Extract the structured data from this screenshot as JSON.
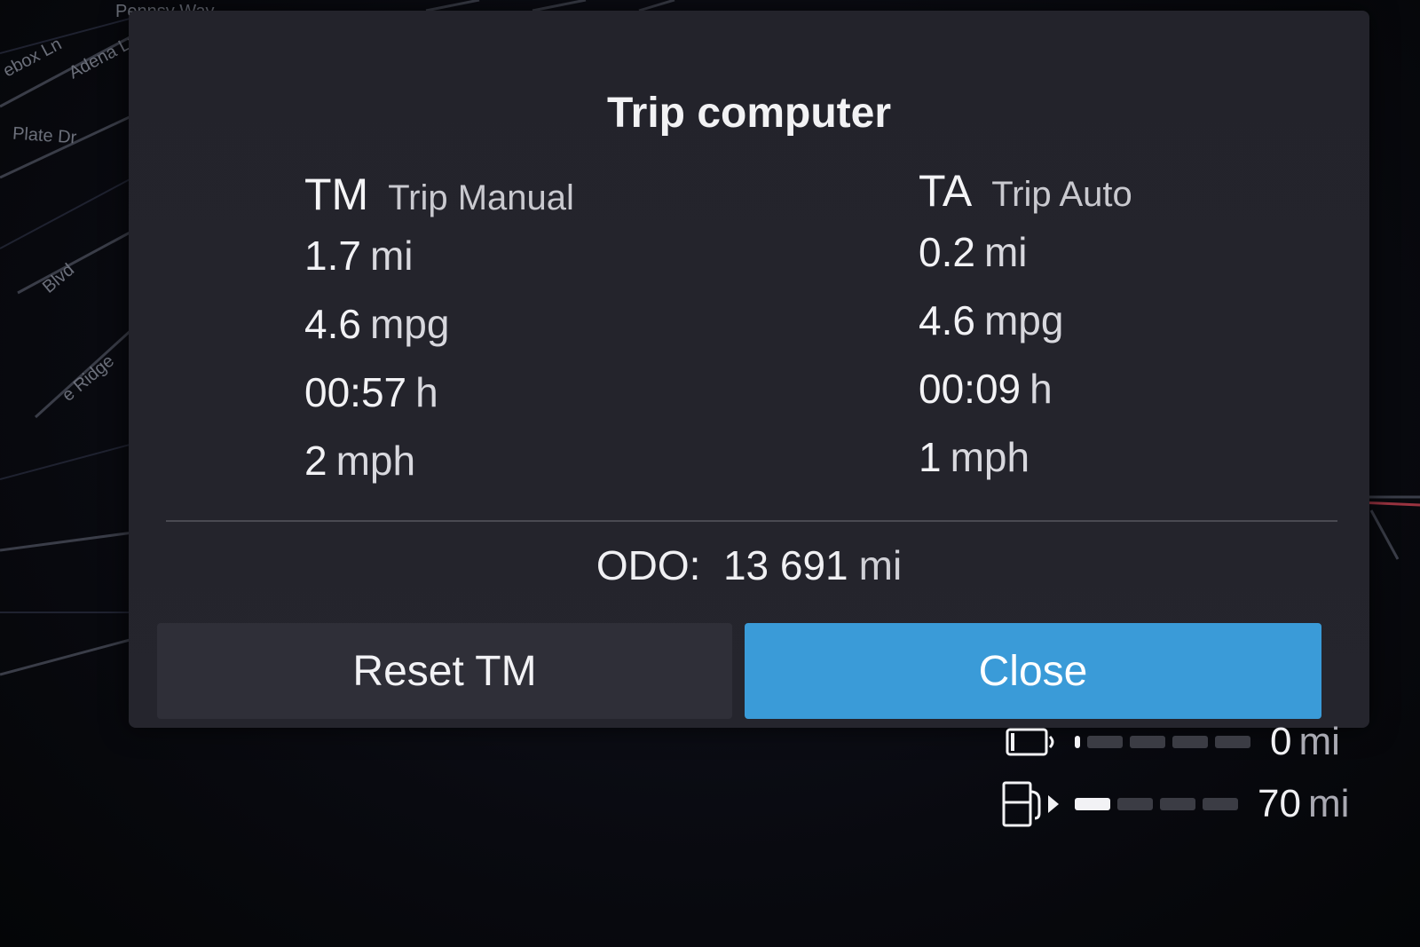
{
  "map": {
    "streets": [
      "Pennsy Way",
      "Adena Ln",
      "Plate Dr",
      "ebox Ln",
      "Blvd",
      "e Ridge"
    ]
  },
  "dialog": {
    "title": "Trip computer",
    "trip_manual": {
      "code": "TM",
      "name": "Trip Manual",
      "rows": [
        {
          "value": "1.7",
          "unit": "mi"
        },
        {
          "value": "4.6",
          "unit": "mpg"
        },
        {
          "value": "00:57",
          "unit": "h"
        },
        {
          "value": "2",
          "unit": "mph"
        }
      ]
    },
    "trip_auto": {
      "code": "TA",
      "name": "Trip Auto",
      "rows": [
        {
          "value": "0.2",
          "unit": "mi"
        },
        {
          "value": "4.6",
          "unit": "mpg"
        },
        {
          "value": "00:09",
          "unit": "h"
        },
        {
          "value": "1",
          "unit": "mph"
        }
      ]
    },
    "odo": {
      "label": "ODO:",
      "value": "13 691",
      "unit": "mi"
    },
    "buttons": {
      "reset_label": "Reset TM",
      "close_label": "Close"
    }
  },
  "range": {
    "battery": {
      "value": "0",
      "unit": "mi",
      "icon": "battery-icon",
      "level": 0.0
    },
    "fuel": {
      "value": "70",
      "unit": "mi",
      "icon": "fuel-pump-icon",
      "level": 0.25
    }
  },
  "colors": {
    "accent": "#3a9bd8",
    "dialog_bg": "#24242c",
    "button_bg": "#2f2f38"
  }
}
